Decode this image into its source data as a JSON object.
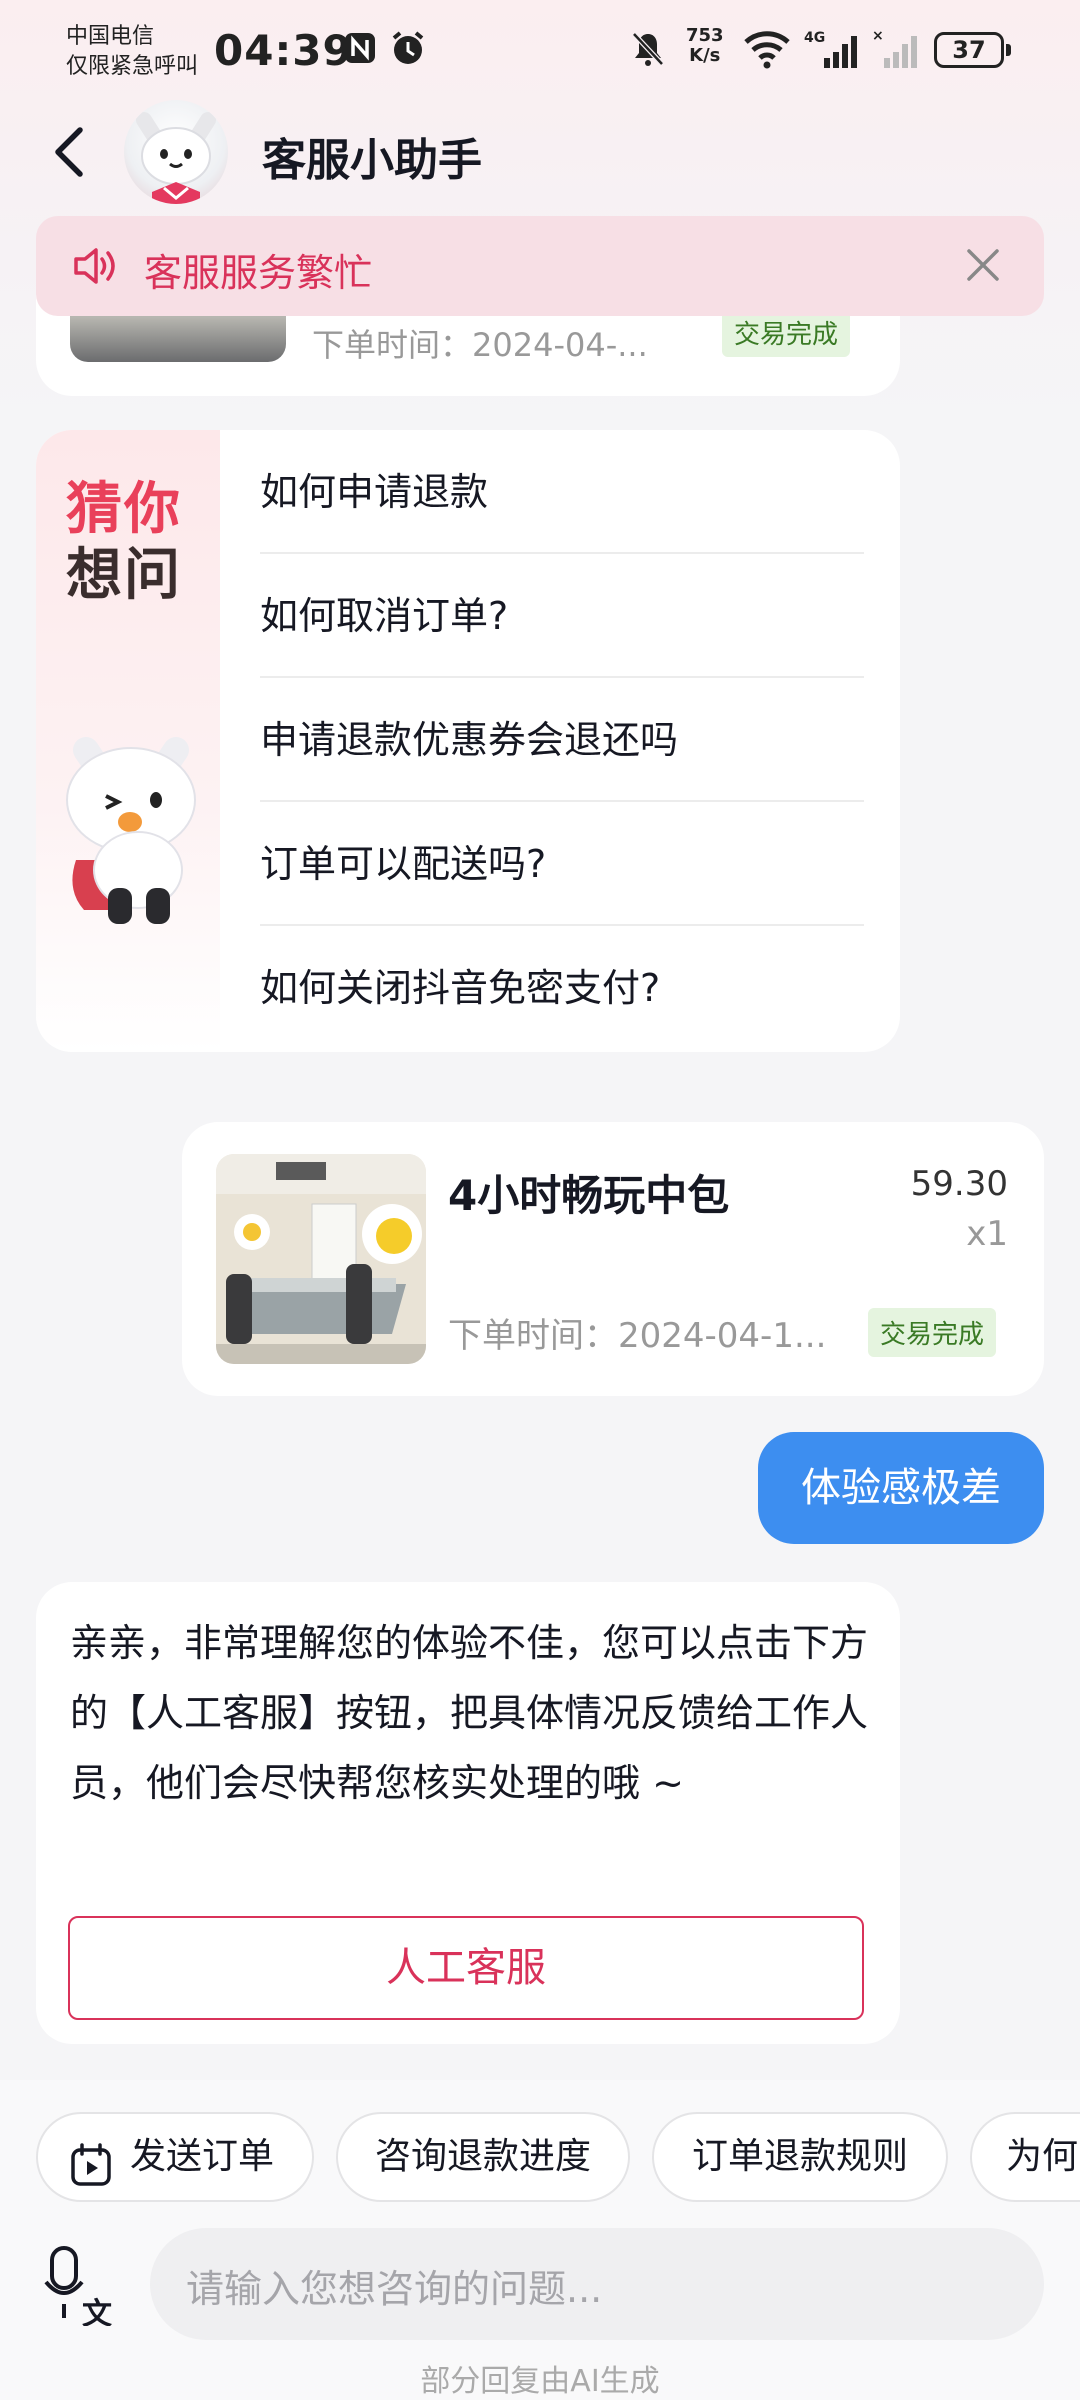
{
  "status_bar": {
    "carrier_line1": "中国电信",
    "carrier_line2": "仅限紧急呼叫",
    "time": "04:39",
    "net_speed_value": "753",
    "net_speed_unit": "K/s",
    "battery": "37",
    "icons": [
      "nfc-icon",
      "alarm-icon",
      "mute-icon",
      "wifi-icon",
      "signal-4g-icon",
      "signal-none-icon",
      "battery-icon"
    ]
  },
  "header": {
    "title": "客服小助手"
  },
  "notice": {
    "text": "客服服务繁忙"
  },
  "order_partial": {
    "time": "下单时间：2024-04-...",
    "status": "交易完成"
  },
  "guess": {
    "title_line1": "猜你",
    "title_line2": "想问",
    "questions": [
      "如何申请退款",
      "如何取消订单?",
      "申请退款优惠券会退还吗",
      "订单可以配送吗?",
      "如何关闭抖音免密支付?"
    ]
  },
  "order_card": {
    "name": "4小时畅玩中包",
    "price": "59.30",
    "quantity": "x1",
    "time": "下单时间：2024-04-1...",
    "status": "交易完成"
  },
  "user_message": "体验感极差",
  "bot_reply": {
    "text": "亲亲，非常理解您的体验不佳，您可以点击下方的【人工客服】按钮，把具体情况反馈给工作人员，他们会尽快帮您核实处理的哦 ~",
    "button": "人工客服"
  },
  "quick_actions": [
    "发送订单",
    "咨询退款进度",
    "订单退款规则",
    "为何"
  ],
  "input": {
    "placeholder": "请输入您想咨询的问题..."
  },
  "footnote": "部分回复由AI生成",
  "colors": {
    "accent": "#d9325a",
    "user_bubble": "#3d8ef0",
    "tag_green": "#3a7a25"
  }
}
